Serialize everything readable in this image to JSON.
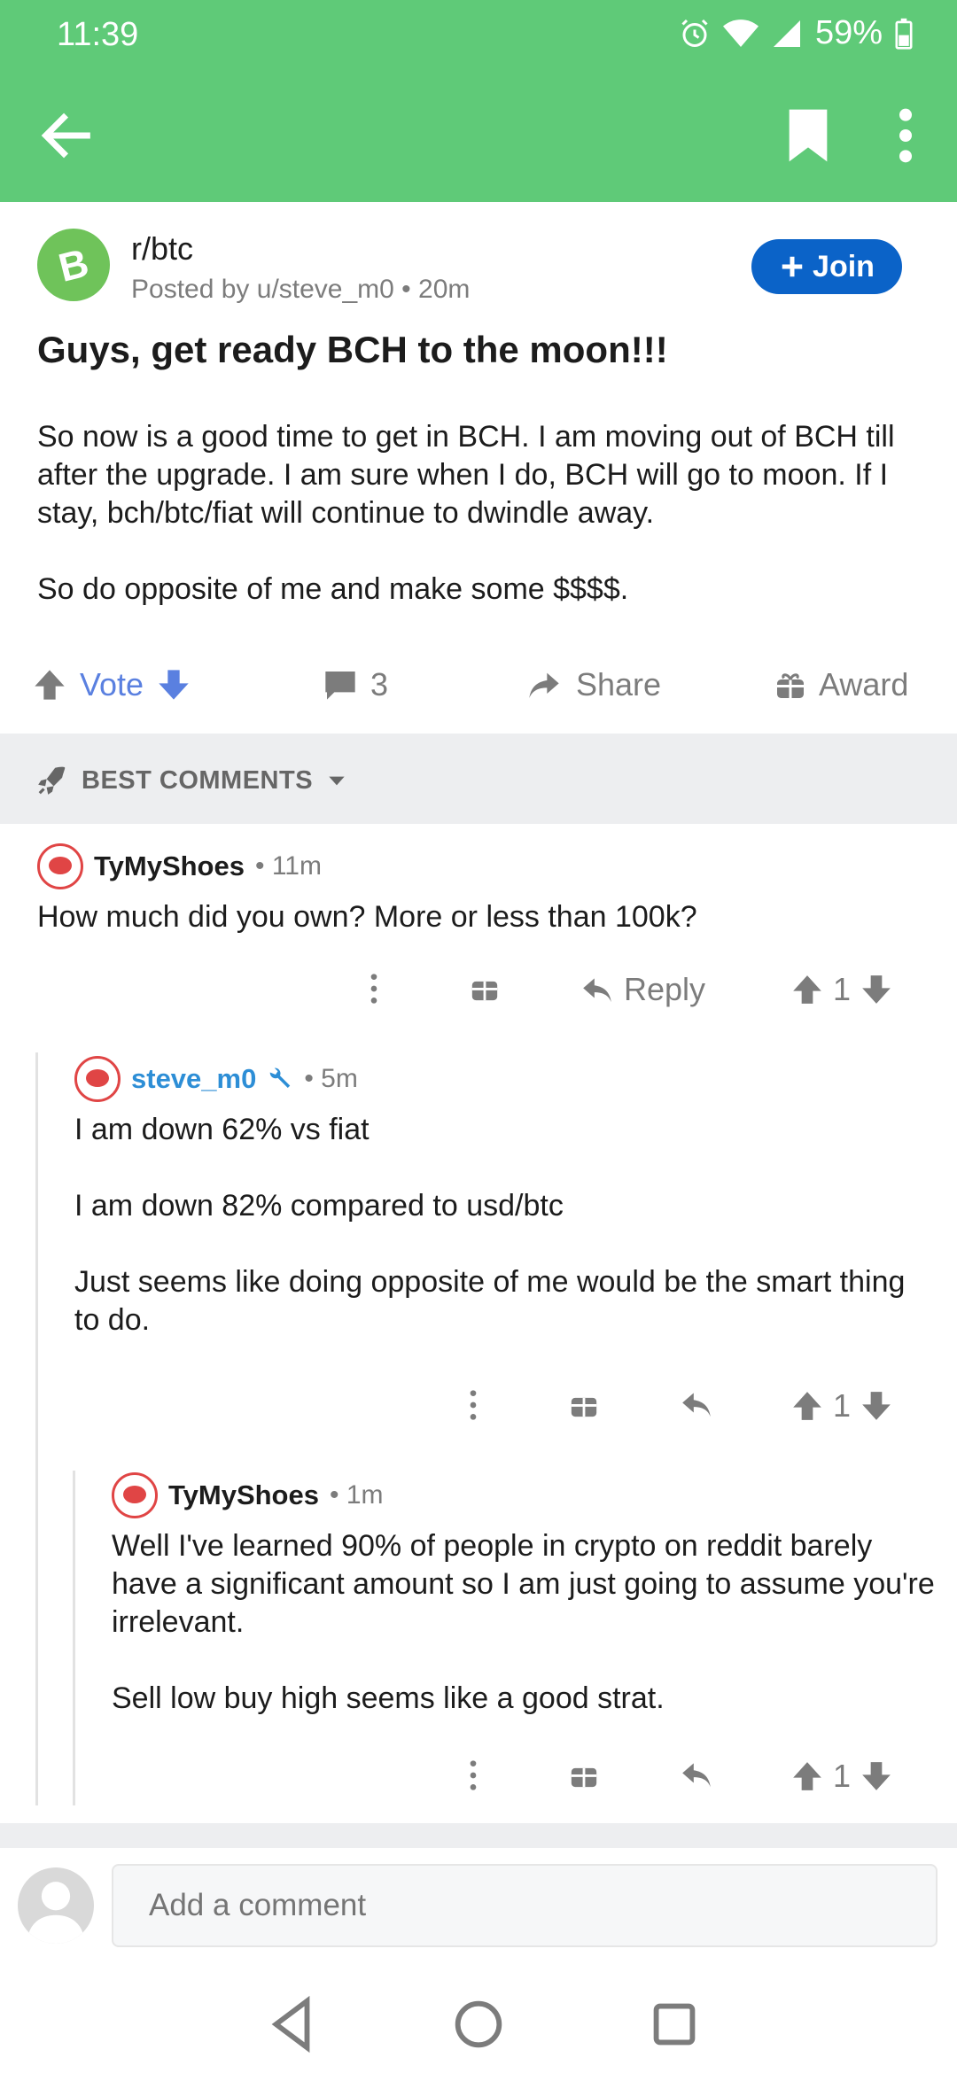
{
  "status": {
    "time": "11:39",
    "battery": "59%"
  },
  "post": {
    "subreddit": "r/btc",
    "posted_by": "Posted by u/steve_m0 • 20m",
    "join_label": "Join",
    "title": "Guys, get ready BCH to the moon!!!",
    "body": [
      "So now is a good time to get in BCH.  I am moving out of BCH till after the upgrade.  I am sure when I do, BCH will go to moon.  If I stay, bch/btc/fiat will continue to dwindle away.",
      "So do opposite of me and make some $$$$."
    ],
    "vote_label": "Vote",
    "comment_count": "3",
    "share_label": "Share",
    "award_label": "Award"
  },
  "sort": {
    "label": "BEST COMMENTS"
  },
  "comments": [
    {
      "author": "TyMyShoes",
      "meta": "• 11m",
      "text": [
        "How much did you own? More or less than 100k?"
      ],
      "reply_label": "Reply",
      "score": "1"
    },
    {
      "author": "steve_m0",
      "meta": "• 5m",
      "text": [
        "I am down 62% vs fiat",
        "I am down 82% compared to usd/btc",
        "Just seems like doing opposite of me would be the smart thing to do."
      ],
      "score": "1"
    },
    {
      "author": "TyMyShoes",
      "meta": "• 1m",
      "text": [
        "Well I've learned 90% of people in crypto on reddit barely have a significant amount so I am just going to assume you're irrelevant.",
        "Sell low buy high seems like a good strat."
      ],
      "score": "1"
    }
  ],
  "composer": {
    "placeholder": "Add a comment"
  },
  "colors": {
    "app_bar": "#5fca78",
    "join": "#0b63c8",
    "op_name": "#2d8ed6",
    "vote": "#5a80e0"
  }
}
